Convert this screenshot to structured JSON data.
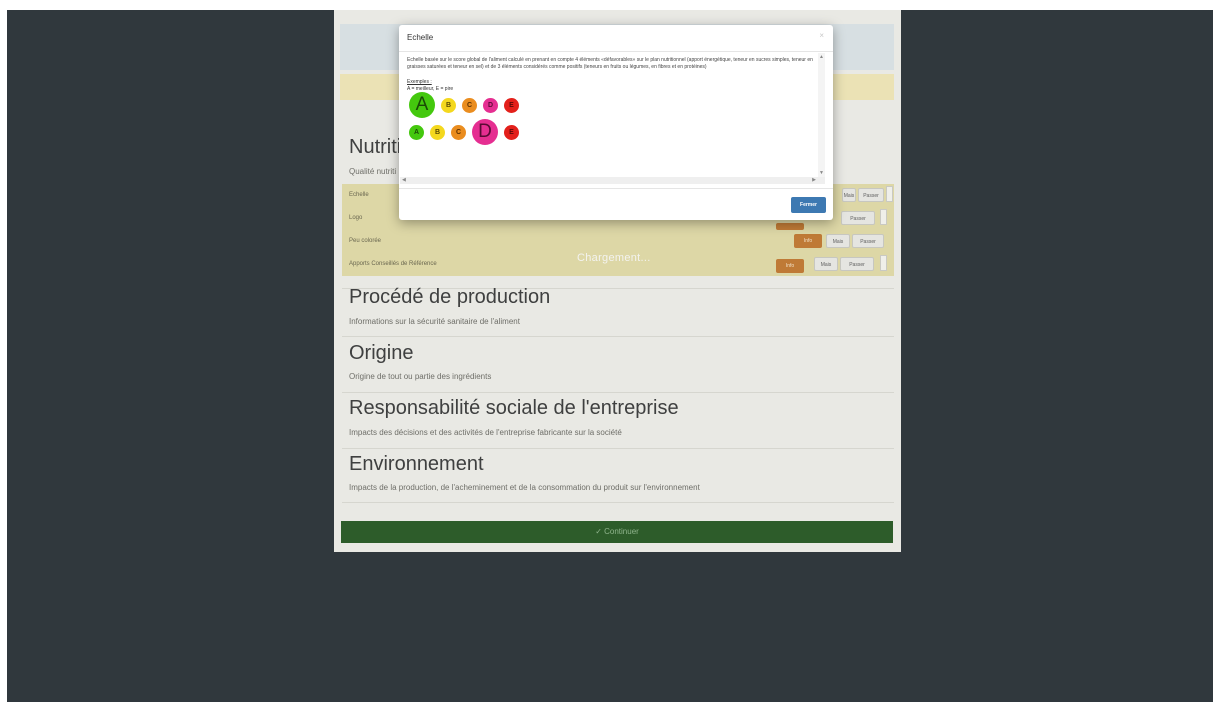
{
  "page": {
    "section_nutrition": {
      "title": "Nutritio",
      "subtitle": "Qualité nutriti",
      "rows": [
        {
          "label": "Echelle",
          "info": "",
          "yes": "Mais",
          "no": "Passer"
        },
        {
          "label": "Logo",
          "info": "",
          "yes": "",
          "no": "Passer"
        },
        {
          "label": "Peu colorée",
          "info": "Info",
          "yes": "Mais",
          "no": "Passer"
        },
        {
          "label": "Apports Conseillés de Référence",
          "info": "Info",
          "yes": "Mais",
          "no": "Passer"
        }
      ]
    },
    "loading_text": "Chargement...",
    "sections": [
      {
        "title": "Procédé de production",
        "subtitle": "Informations sur la sécurité sanitaire de l'aliment"
      },
      {
        "title": "Origine",
        "subtitle": "Origine de tout ou partie des ingrédients"
      },
      {
        "title": "Responsabilité sociale de l'entreprise",
        "subtitle": "Impacts des décisions et des activités de l'entreprise fabricante sur la société"
      },
      {
        "title": "Environnement",
        "subtitle": "Impacts de la production, de l'acheminement et de la consommation du produit sur l'environnement"
      }
    ],
    "continue_label": "Continuer",
    "continue_icon": "check-circle-icon"
  },
  "modal": {
    "title": "Echelle",
    "close_glyph": "×",
    "description": "Echelle basée sur le score global de l'aliment calculé en prenant en compte 4 éléments «défavorables» sur le plan nutritionnel (apport énergétique, teneur en sucres simples, teneur en graisses saturées et teneur en sel) et de 3 éléments considérés comme positifs (teneurs en fruits ou légumes, en fibres et en protéines)",
    "examples_title": "Exemples :",
    "examples_legend": "A = meilleur, E = pire",
    "example_rows": [
      {
        "selected": "A",
        "grades": [
          "A",
          "B",
          "C",
          "D",
          "E"
        ]
      },
      {
        "selected": "D",
        "grades": [
          "A",
          "B",
          "C",
          "D",
          "E"
        ]
      }
    ],
    "grade_colors": {
      "A": "#44c80e",
      "B": "#f4d81e",
      "C": "#ea8d1f",
      "D": "#e52e91",
      "E": "#e3201b"
    },
    "close_button_label": "Fermer"
  }
}
